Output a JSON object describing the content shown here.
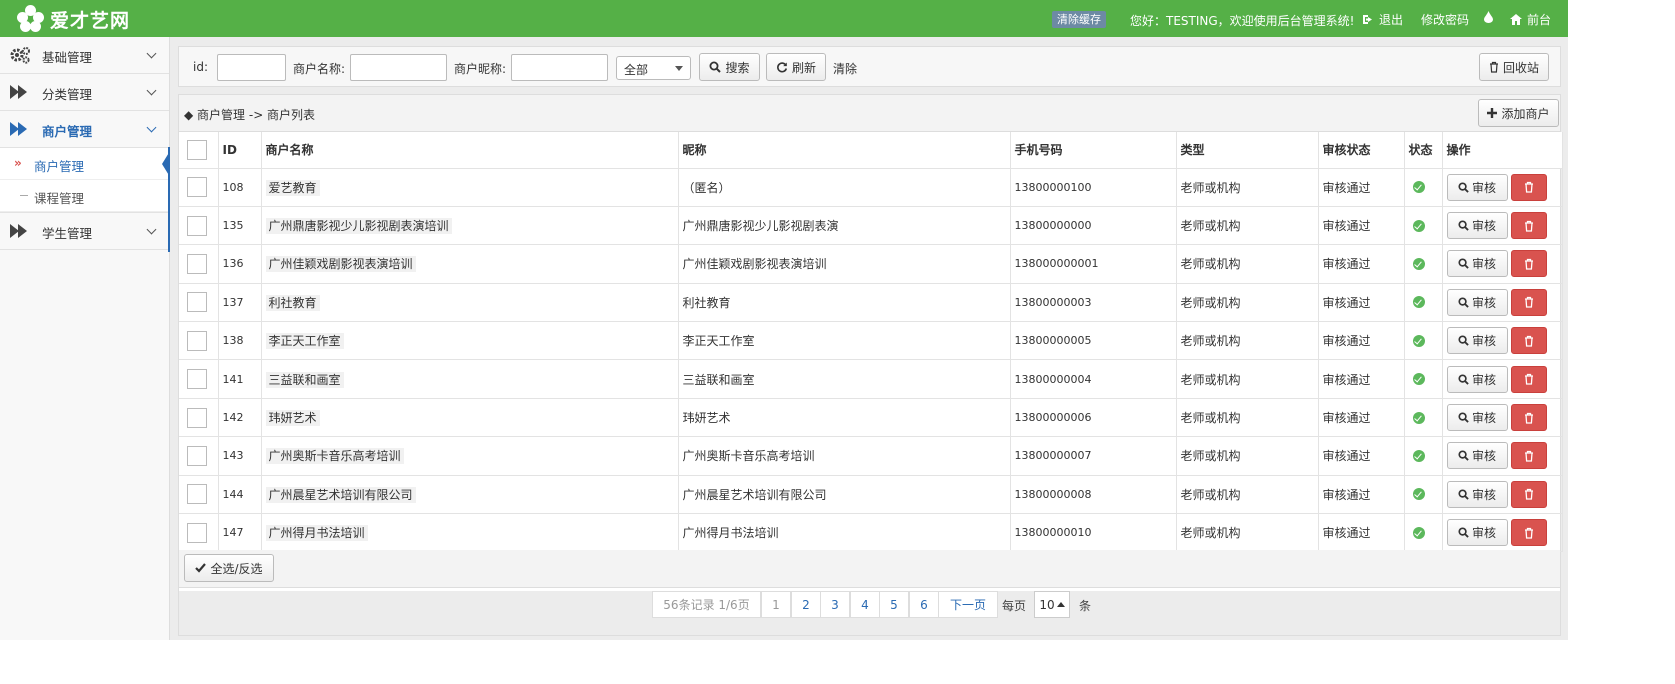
{
  "brand": {
    "name": "爱才艺网"
  },
  "topbar": {
    "clear_cache": "清除缓存",
    "welcome": "您好：TESTING，欢迎使用后台管理系统!",
    "logout": "退出",
    "change_password": "修改密码",
    "front": "前台"
  },
  "sidebar": {
    "groups": [
      {
        "label": "基础管理",
        "icon": "gears-icon"
      },
      {
        "label": "分类管理",
        "icon": "double-arrow-icon"
      },
      {
        "label": "商户管理",
        "icon": "double-arrow-icon",
        "active": true,
        "items": [
          {
            "label": "商户管理",
            "active": true
          },
          {
            "label": "课程管理"
          }
        ]
      },
      {
        "label": "学生管理",
        "icon": "double-arrow-icon"
      }
    ]
  },
  "search": {
    "id_label": "id:",
    "name_label": "商户名称:",
    "nick_label": "商户昵称:",
    "id_value": "",
    "name_value": "",
    "nick_value": "",
    "select_value": "全部",
    "search_btn": "搜索",
    "refresh_btn": "刷新",
    "clear_link": "清除",
    "recycle_btn": "回收站"
  },
  "breadcrumb": {
    "text": "◆ 商户管理 -> 商户列表"
  },
  "add_btn": "添加商户",
  "table": {
    "headers": [
      "ID",
      "商户名称",
      "昵称",
      "手机号码",
      "类型",
      "审核状态",
      "状态",
      "操作"
    ],
    "audit_label": "审核",
    "rows": [
      {
        "id": "108",
        "name": "爱艺教育",
        "nick": "（匿名）",
        "phone": "13800000100",
        "type": "老师或机构",
        "audit": "审核通过"
      },
      {
        "id": "135",
        "name": "广州鼎唐影视少儿影视剧表演培训",
        "nick": "广州鼎唐影视少儿影视剧表演",
        "phone": "13800000000",
        "type": "老师或机构",
        "audit": "审核通过"
      },
      {
        "id": "136",
        "name": "广州佳颖戏剧影视表演培训",
        "nick": "广州佳颖戏剧影视表演培训",
        "phone": "138000000001",
        "type": "老师或机构",
        "audit": "审核通过"
      },
      {
        "id": "137",
        "name": "利社教育",
        "nick": "利社教育",
        "phone": "13800000003",
        "type": "老师或机构",
        "audit": "审核通过"
      },
      {
        "id": "138",
        "name": "李正天工作室",
        "nick": "李正天工作室",
        "phone": "13800000005",
        "type": "老师或机构",
        "audit": "审核通过"
      },
      {
        "id": "141",
        "name": "三益联和画室",
        "nick": "三益联和画室",
        "phone": "13800000004",
        "type": "老师或机构",
        "audit": "审核通过"
      },
      {
        "id": "142",
        "name": "玮妍艺术",
        "nick": "玮妍艺术",
        "phone": "13800000006",
        "type": "老师或机构",
        "audit": "审核通过"
      },
      {
        "id": "143",
        "name": "广州奥斯卡音乐高考培训",
        "nick": "广州奥斯卡音乐高考培训",
        "phone": "13800000007",
        "type": "老师或机构",
        "audit": "审核通过"
      },
      {
        "id": "144",
        "name": "广州晨星艺术培训有限公司",
        "nick": "广州晨星艺术培训有限公司",
        "phone": "13800000008",
        "type": "老师或机构",
        "audit": "审核通过"
      },
      {
        "id": "147",
        "name": "广州得月书法培训",
        "nick": "广州得月书法培训",
        "phone": "13800000010",
        "type": "老师或机构",
        "audit": "审核通过"
      }
    ]
  },
  "select_all_btn": "全选/反选",
  "pagination": {
    "summary": "56条记录 1/6页",
    "pages": [
      "1",
      "2",
      "3",
      "4",
      "5",
      "6"
    ],
    "current": "1",
    "next": "下一页",
    "per_page_label": "每页",
    "per_page_value": "10",
    "unit": "条"
  },
  "colors": {
    "topbar": "#55b047",
    "accent": "#2a6ab3",
    "danger": "#d9534f",
    "ok": "#5cb85c"
  }
}
